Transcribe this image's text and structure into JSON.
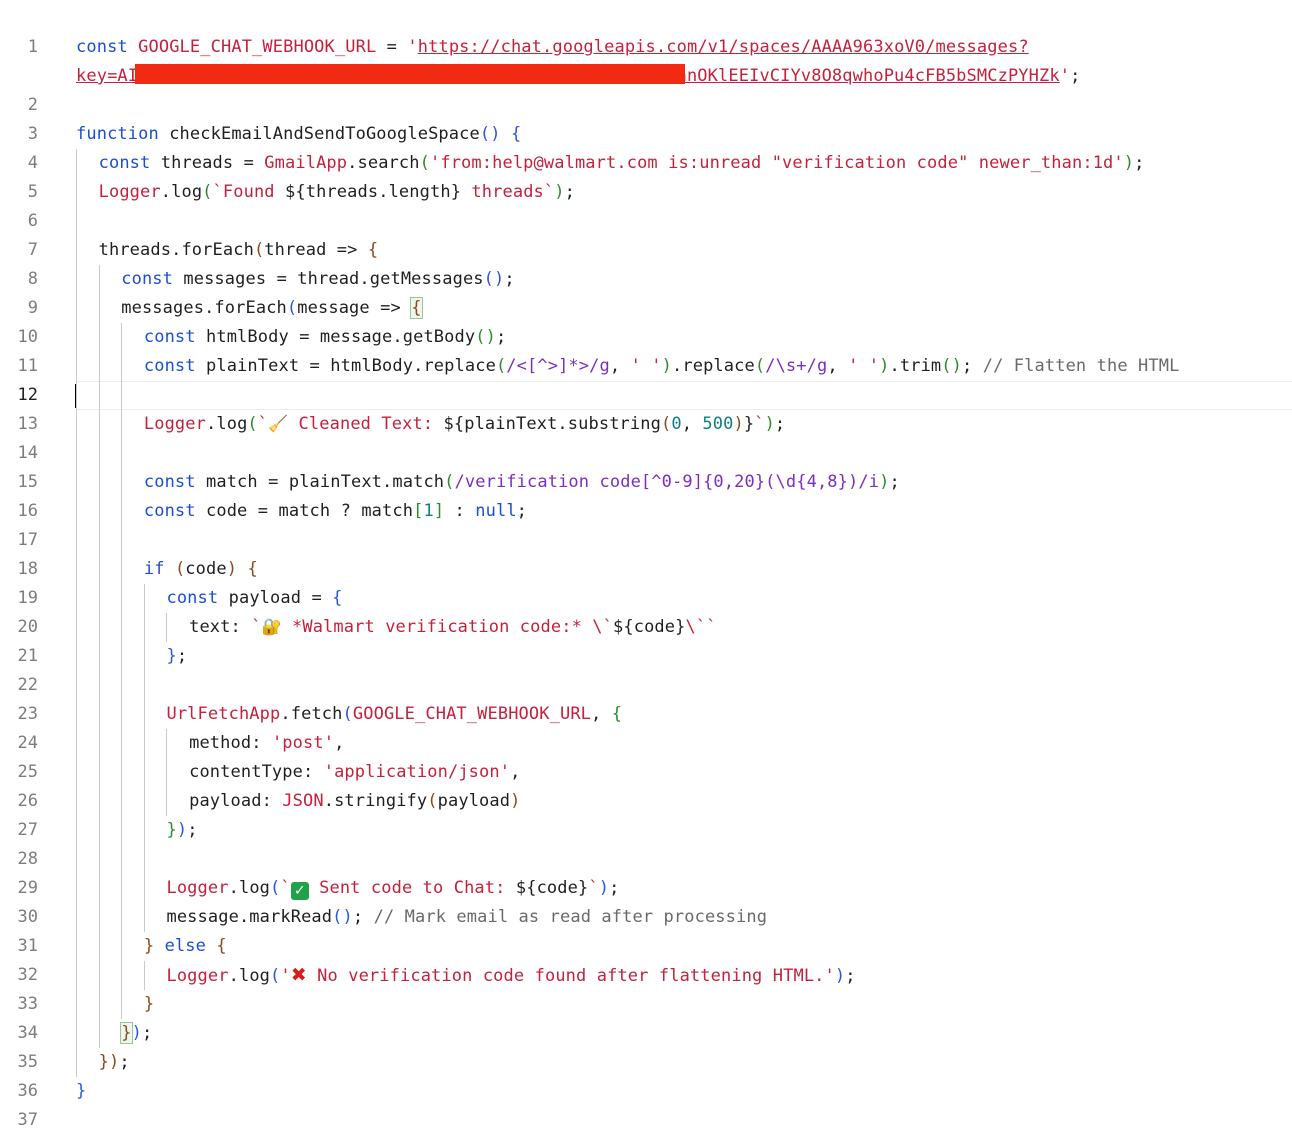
{
  "editor": {
    "active_line": 12,
    "lines": [
      {
        "n": "1",
        "t": [
          [
            "kw",
            "const"
          ],
          [
            "sp",
            " "
          ],
          [
            "var",
            "GOOGLE_CHAT_WEBHOOK_URL"
          ],
          [
            "sp",
            " = "
          ],
          [
            "str",
            "'"
          ],
          [
            "url",
            "https://chat.googleapis.com/v1/spaces/AAAA963xoV0/messages?"
          ]
        ]
      },
      {
        "n": "",
        "t": [
          [
            "url",
            "key=AI"
          ],
          [
            "url",
            "                                                  "
          ],
          [
            "url",
            "KdnnOKlEEIvCIYv8O8qwhoPu4cFB5bSMCzPYHZk"
          ],
          [
            "str",
            "'"
          ],
          [
            "sp",
            ";"
          ]
        ]
      },
      {
        "n": "2",
        "t": []
      },
      {
        "n": "3",
        "t": [
          [
            "kw",
            "function"
          ],
          [
            "sp",
            " checkEmailAndSendToGoogleSpace"
          ],
          [
            "p1",
            "()"
          ],
          [
            "sp",
            " "
          ],
          [
            "p1",
            "{"
          ]
        ]
      },
      {
        "n": "4",
        "t": [
          [
            "kw",
            "const"
          ],
          [
            "sp",
            " threads = "
          ],
          [
            "cls",
            "GmailApp"
          ],
          [
            "sp",
            ".search"
          ],
          [
            "p2",
            "("
          ],
          [
            "str",
            "'from:help@walmart.com is:unread \"verification code\" newer_than:1d'"
          ],
          [
            "p2",
            ")"
          ],
          [
            "sp",
            ";"
          ]
        ]
      },
      {
        "n": "5",
        "t": [
          [
            "cls",
            "Logger"
          ],
          [
            "sp",
            ".log"
          ],
          [
            "p2",
            "("
          ],
          [
            "str",
            "`Found "
          ],
          [
            "sp",
            "${threads.length}"
          ],
          [
            "str",
            " threads`"
          ],
          [
            "p2",
            ")"
          ],
          [
            "sp",
            ";"
          ]
        ]
      },
      {
        "n": "6",
        "t": []
      },
      {
        "n": "7",
        "t": [
          [
            "sp",
            "threads.forEach"
          ],
          [
            "p3",
            "("
          ],
          [
            "sp",
            "thread => "
          ],
          [
            "p3",
            "{"
          ]
        ]
      },
      {
        "n": "8",
        "t": [
          [
            "kw",
            "const"
          ],
          [
            "sp",
            " messages = thread.getMessages"
          ],
          [
            "p1",
            "()"
          ],
          [
            "sp",
            ";"
          ]
        ]
      },
      {
        "n": "9",
        "t": [
          [
            "sp",
            "messages.forEach"
          ],
          [
            "p1",
            "("
          ],
          [
            "sp",
            "message => "
          ],
          [
            "box",
            "{"
          ]
        ]
      },
      {
        "n": "10",
        "t": [
          [
            "kw",
            "const"
          ],
          [
            "sp",
            " htmlBody = message.getBody"
          ],
          [
            "p2",
            "()"
          ],
          [
            "sp",
            ";"
          ]
        ]
      },
      {
        "n": "11",
        "t": [
          [
            "kw",
            "const"
          ],
          [
            "sp",
            " plainText = htmlBody.replace"
          ],
          [
            "p2",
            "("
          ],
          [
            "re",
            "/<[^>]*>/g"
          ],
          [
            "sp",
            ", "
          ],
          [
            "str",
            "' '"
          ],
          [
            "p2",
            ")"
          ],
          [
            "sp",
            ".replace"
          ],
          [
            "p2",
            "("
          ],
          [
            "re",
            "/\\s+/g"
          ],
          [
            "sp",
            ", "
          ],
          [
            "str",
            "' '"
          ],
          [
            "p2",
            ")"
          ],
          [
            "sp",
            ".trim"
          ],
          [
            "p2",
            "()"
          ],
          [
            "sp",
            "; "
          ],
          [
            "cm",
            "// Flatten the HTML"
          ]
        ]
      },
      {
        "n": "12",
        "t": []
      },
      {
        "n": "13",
        "t": [
          [
            "cls",
            "Logger"
          ],
          [
            "sp",
            ".log"
          ],
          [
            "p2",
            "("
          ],
          [
            "str",
            "`"
          ],
          [
            "emoji",
            "🧹"
          ],
          [
            "str",
            " Cleaned Text: "
          ],
          [
            "sp",
            "${plainText.substring"
          ],
          [
            "p3",
            "("
          ],
          [
            "num",
            "0"
          ],
          [
            "sp",
            ", "
          ],
          [
            "num",
            "500"
          ],
          [
            "p3",
            ")"
          ],
          [
            "sp",
            "}"
          ],
          [
            "str",
            "`"
          ],
          [
            "p2",
            ")"
          ],
          [
            "sp",
            ";"
          ]
        ]
      },
      {
        "n": "14",
        "t": []
      },
      {
        "n": "15",
        "t": [
          [
            "kw",
            "const"
          ],
          [
            "sp",
            " match = plainText.match"
          ],
          [
            "p2",
            "("
          ],
          [
            "re",
            "/verification code[^0-9]{0,20}(\\d{4,8})/i"
          ],
          [
            "p2",
            ")"
          ],
          [
            "sp",
            ";"
          ]
        ]
      },
      {
        "n": "16",
        "t": [
          [
            "kw",
            "const"
          ],
          [
            "sp",
            " code = match ? match"
          ],
          [
            "p2",
            "["
          ],
          [
            "num",
            "1"
          ],
          [
            "p2",
            "]"
          ],
          [
            "sp",
            " : "
          ],
          [
            "kw",
            "null"
          ],
          [
            "sp",
            ";"
          ]
        ]
      },
      {
        "n": "17",
        "t": []
      },
      {
        "n": "18",
        "t": [
          [
            "kw",
            "if"
          ],
          [
            "sp",
            " "
          ],
          [
            "p3",
            "("
          ],
          [
            "sp",
            "code"
          ],
          [
            "p3",
            ")"
          ],
          [
            "sp",
            " "
          ],
          [
            "p3",
            "{"
          ]
        ]
      },
      {
        "n": "19",
        "t": [
          [
            "kw",
            "const"
          ],
          [
            "sp",
            " payload = "
          ],
          [
            "p1",
            "{"
          ]
        ]
      },
      {
        "n": "20",
        "t": [
          [
            "sp",
            "text: "
          ],
          [
            "str",
            "`"
          ],
          [
            "emoji",
            "🔐"
          ],
          [
            "str",
            " *Walmart verification code:* \\`"
          ],
          [
            "sp",
            "${code}"
          ],
          [
            "str",
            "\\``"
          ]
        ]
      },
      {
        "n": "21",
        "t": [
          [
            "p1",
            "}"
          ],
          [
            "sp",
            ";"
          ]
        ]
      },
      {
        "n": "22",
        "t": []
      },
      {
        "n": "23",
        "t": [
          [
            "cls",
            "UrlFetchApp"
          ],
          [
            "sp",
            ".fetch"
          ],
          [
            "p1",
            "("
          ],
          [
            "var",
            "GOOGLE_CHAT_WEBHOOK_URL"
          ],
          [
            "sp",
            ", "
          ],
          [
            "p2",
            "{"
          ]
        ]
      },
      {
        "n": "24",
        "t": [
          [
            "sp",
            "method: "
          ],
          [
            "str",
            "'post'"
          ],
          [
            "sp",
            ","
          ]
        ]
      },
      {
        "n": "25",
        "t": [
          [
            "sp",
            "contentType: "
          ],
          [
            "str",
            "'application/json'"
          ],
          [
            "sp",
            ","
          ]
        ]
      },
      {
        "n": "26",
        "t": [
          [
            "sp",
            "payload: "
          ],
          [
            "cls",
            "JSON"
          ],
          [
            "sp",
            ".stringify"
          ],
          [
            "p3",
            "("
          ],
          [
            "sp",
            "payload"
          ],
          [
            "p3",
            ")"
          ]
        ]
      },
      {
        "n": "27",
        "t": [
          [
            "p2",
            "}"
          ],
          [
            "p1",
            ")"
          ],
          [
            "sp",
            ";"
          ]
        ]
      },
      {
        "n": "28",
        "t": []
      },
      {
        "n": "29",
        "t": [
          [
            "cls",
            "Logger"
          ],
          [
            "sp",
            ".log"
          ],
          [
            "p1",
            "("
          ],
          [
            "str",
            "`"
          ],
          [
            "check",
            "✓"
          ],
          [
            "str",
            " Sent code to Chat: "
          ],
          [
            "sp",
            "${code}"
          ],
          [
            "str",
            "`"
          ],
          [
            "p1",
            ")"
          ],
          [
            "sp",
            ";"
          ]
        ]
      },
      {
        "n": "30",
        "t": [
          [
            "sp",
            "message.markRead"
          ],
          [
            "p1",
            "()"
          ],
          [
            "sp",
            "; "
          ],
          [
            "cm",
            "// Mark email as read after processing"
          ]
        ]
      },
      {
        "n": "31",
        "t": [
          [
            "p3",
            "}"
          ],
          [
            "sp",
            " "
          ],
          [
            "kw",
            "else"
          ],
          [
            "sp",
            " "
          ],
          [
            "p3",
            "{"
          ]
        ]
      },
      {
        "n": "32",
        "t": [
          [
            "cls",
            "Logger"
          ],
          [
            "sp",
            ".log"
          ],
          [
            "p1",
            "("
          ],
          [
            "str",
            "'"
          ],
          [
            "x",
            "✖"
          ],
          [
            "str",
            " No verification code found after flattening HTML.'"
          ],
          [
            "p1",
            ")"
          ],
          [
            "sp",
            ";"
          ]
        ]
      },
      {
        "n": "33",
        "t": [
          [
            "p3",
            "}"
          ]
        ]
      },
      {
        "n": "34",
        "t": [
          [
            "box",
            "}"
          ],
          [
            "p1",
            ")"
          ],
          [
            "sp",
            ";"
          ]
        ]
      },
      {
        "n": "35",
        "t": [
          [
            "p3",
            "}"
          ],
          [
            "p3",
            ")"
          ],
          [
            "sp",
            ";"
          ]
        ]
      },
      {
        "n": "36",
        "t": [
          [
            "p1",
            "}"
          ]
        ]
      },
      {
        "n": "37",
        "t": []
      }
    ]
  }
}
